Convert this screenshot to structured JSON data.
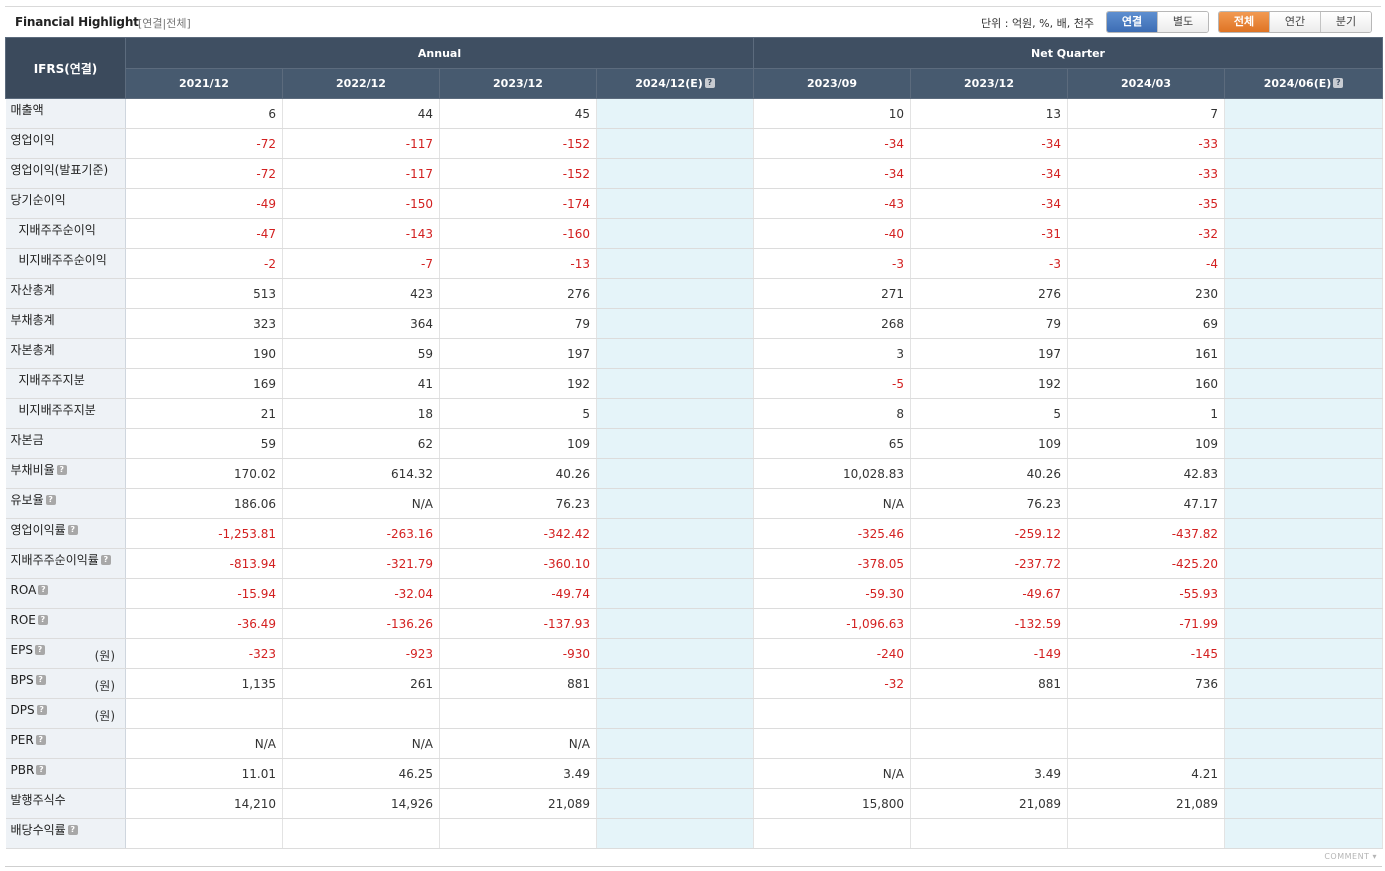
{
  "header": {
    "title": "Financial Highlight",
    "subtitle": "[연결|전체]",
    "unit_label": "단위 : 억원, %, 배, 천주",
    "scope_buttons": [
      "연결",
      "별도"
    ],
    "scope_active": "연결",
    "period_buttons": [
      "전체",
      "연간",
      "분기"
    ],
    "period_active": "전체"
  },
  "table": {
    "corner": "IFRS(연결)",
    "groups": [
      "Annual",
      "Net Quarter"
    ],
    "columns": [
      "2021/12",
      "2022/12",
      "2023/12",
      "2024/12(E)",
      "2023/09",
      "2023/12",
      "2024/03",
      "2024/06(E)"
    ],
    "estimate_columns": [
      3,
      7
    ],
    "rows": [
      {
        "label": "매출액",
        "indent": false,
        "help": false,
        "unit": "",
        "values": [
          "6",
          "44",
          "45",
          "",
          "10",
          "13",
          "7",
          ""
        ]
      },
      {
        "label": "영업이익",
        "indent": false,
        "help": false,
        "unit": "",
        "values": [
          "-72",
          "-117",
          "-152",
          "",
          "-34",
          "-34",
          "-33",
          ""
        ]
      },
      {
        "label": "영업이익(발표기준)",
        "indent": false,
        "help": false,
        "unit": "",
        "values": [
          "-72",
          "-117",
          "-152",
          "",
          "-34",
          "-34",
          "-33",
          ""
        ]
      },
      {
        "label": "당기순이익",
        "indent": false,
        "help": false,
        "unit": "",
        "values": [
          "-49",
          "-150",
          "-174",
          "",
          "-43",
          "-34",
          "-35",
          ""
        ]
      },
      {
        "label": "지배주주순이익",
        "indent": true,
        "help": false,
        "unit": "",
        "values": [
          "-47",
          "-143",
          "-160",
          "",
          "-40",
          "-31",
          "-32",
          ""
        ]
      },
      {
        "label": "비지배주주순이익",
        "indent": true,
        "help": false,
        "unit": "",
        "values": [
          "-2",
          "-7",
          "-13",
          "",
          "-3",
          "-3",
          "-4",
          ""
        ]
      },
      {
        "label": "자산총계",
        "indent": false,
        "help": false,
        "unit": "",
        "values": [
          "513",
          "423",
          "276",
          "",
          "271",
          "276",
          "230",
          ""
        ]
      },
      {
        "label": "부채총계",
        "indent": false,
        "help": false,
        "unit": "",
        "values": [
          "323",
          "364",
          "79",
          "",
          "268",
          "79",
          "69",
          ""
        ]
      },
      {
        "label": "자본총계",
        "indent": false,
        "help": false,
        "unit": "",
        "values": [
          "190",
          "59",
          "197",
          "",
          "3",
          "197",
          "161",
          ""
        ]
      },
      {
        "label": "지배주주지분",
        "indent": true,
        "help": false,
        "unit": "",
        "values": [
          "169",
          "41",
          "192",
          "",
          "-5",
          "192",
          "160",
          ""
        ]
      },
      {
        "label": "비지배주주지분",
        "indent": true,
        "help": false,
        "unit": "",
        "values": [
          "21",
          "18",
          "5",
          "",
          "8",
          "5",
          "1",
          ""
        ]
      },
      {
        "label": "자본금",
        "indent": false,
        "help": false,
        "unit": "",
        "values": [
          "59",
          "62",
          "109",
          "",
          "65",
          "109",
          "109",
          ""
        ]
      },
      {
        "label": "부채비율",
        "indent": false,
        "help": true,
        "unit": "",
        "values": [
          "170.02",
          "614.32",
          "40.26",
          "",
          "10,028.83",
          "40.26",
          "42.83",
          ""
        ]
      },
      {
        "label": "유보율",
        "indent": false,
        "help": true,
        "unit": "",
        "values": [
          "186.06",
          "N/A",
          "76.23",
          "",
          "N/A",
          "76.23",
          "47.17",
          ""
        ]
      },
      {
        "label": "영업이익률",
        "indent": false,
        "help": true,
        "unit": "",
        "values": [
          "-1,253.81",
          "-263.16",
          "-342.42",
          "",
          "-325.46",
          "-259.12",
          "-437.82",
          ""
        ]
      },
      {
        "label": "지배주주순이익률",
        "indent": false,
        "help": true,
        "unit": "",
        "values": [
          "-813.94",
          "-321.79",
          "-360.10",
          "",
          "-378.05",
          "-237.72",
          "-425.20",
          ""
        ]
      },
      {
        "label": "ROA",
        "indent": false,
        "help": true,
        "unit": "",
        "values": [
          "-15.94",
          "-32.04",
          "-49.74",
          "",
          "-59.30",
          "-49.67",
          "-55.93",
          ""
        ]
      },
      {
        "label": "ROE",
        "indent": false,
        "help": true,
        "unit": "",
        "values": [
          "-36.49",
          "-136.26",
          "-137.93",
          "",
          "-1,096.63",
          "-132.59",
          "-71.99",
          ""
        ]
      },
      {
        "label": "EPS",
        "indent": false,
        "help": true,
        "unit": "(원)",
        "values": [
          "-323",
          "-923",
          "-930",
          "",
          "-240",
          "-149",
          "-145",
          ""
        ]
      },
      {
        "label": "BPS",
        "indent": false,
        "help": true,
        "unit": "(원)",
        "values": [
          "1,135",
          "261",
          "881",
          "",
          "-32",
          "881",
          "736",
          ""
        ]
      },
      {
        "label": "DPS",
        "indent": false,
        "help": true,
        "unit": "(원)",
        "values": [
          "",
          "",
          "",
          "",
          "",
          "",
          "",
          ""
        ]
      },
      {
        "label": "PER",
        "indent": false,
        "help": true,
        "unit": "",
        "values": [
          "N/A",
          "N/A",
          "N/A",
          "",
          "",
          "",
          "",
          ""
        ]
      },
      {
        "label": "PBR",
        "indent": false,
        "help": true,
        "unit": "",
        "values": [
          "11.01",
          "46.25",
          "3.49",
          "",
          "N/A",
          "3.49",
          "4.21",
          ""
        ]
      },
      {
        "label": "발행주식수",
        "indent": false,
        "help": false,
        "unit": "",
        "values": [
          "14,210",
          "14,926",
          "21,089",
          "",
          "15,800",
          "21,089",
          "21,089",
          ""
        ]
      },
      {
        "label": "배당수익률",
        "indent": false,
        "help": true,
        "unit": "",
        "values": [
          "",
          "",
          "",
          "",
          "",
          "",
          "",
          ""
        ]
      }
    ]
  },
  "footer": {
    "comment_label": "COMMENT ▾"
  },
  "colors": {
    "header_bg": "#3f4f62",
    "negative": "#d32020",
    "estimate_bg": "#e5f4f9",
    "label_bg": "#eef2f6",
    "active_blue": "#3d6db4",
    "active_orange": "#df7424"
  },
  "icons": {
    "help": "help-icon"
  }
}
